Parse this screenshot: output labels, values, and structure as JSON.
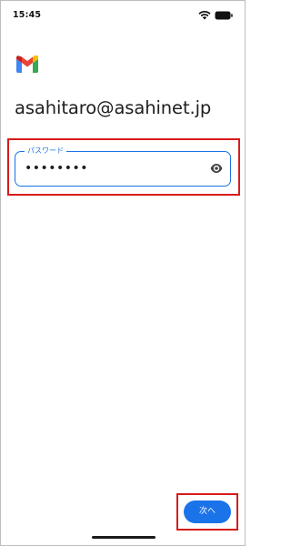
{
  "status_bar": {
    "time": "15:45",
    "icons": [
      "wifi-icon",
      "battery-icon"
    ]
  },
  "app": {
    "logo_icon": "gmail-icon",
    "account_email": "asahitaro@asahinet.jp"
  },
  "password_field": {
    "label": "パスワード",
    "value": "••••••••",
    "toggle_icon": "eye-icon"
  },
  "actions": {
    "next_label": "次へ"
  },
  "colors": {
    "accent": "#1a73e8",
    "highlight": "#d81b1b",
    "text": "#1f1f1f"
  }
}
